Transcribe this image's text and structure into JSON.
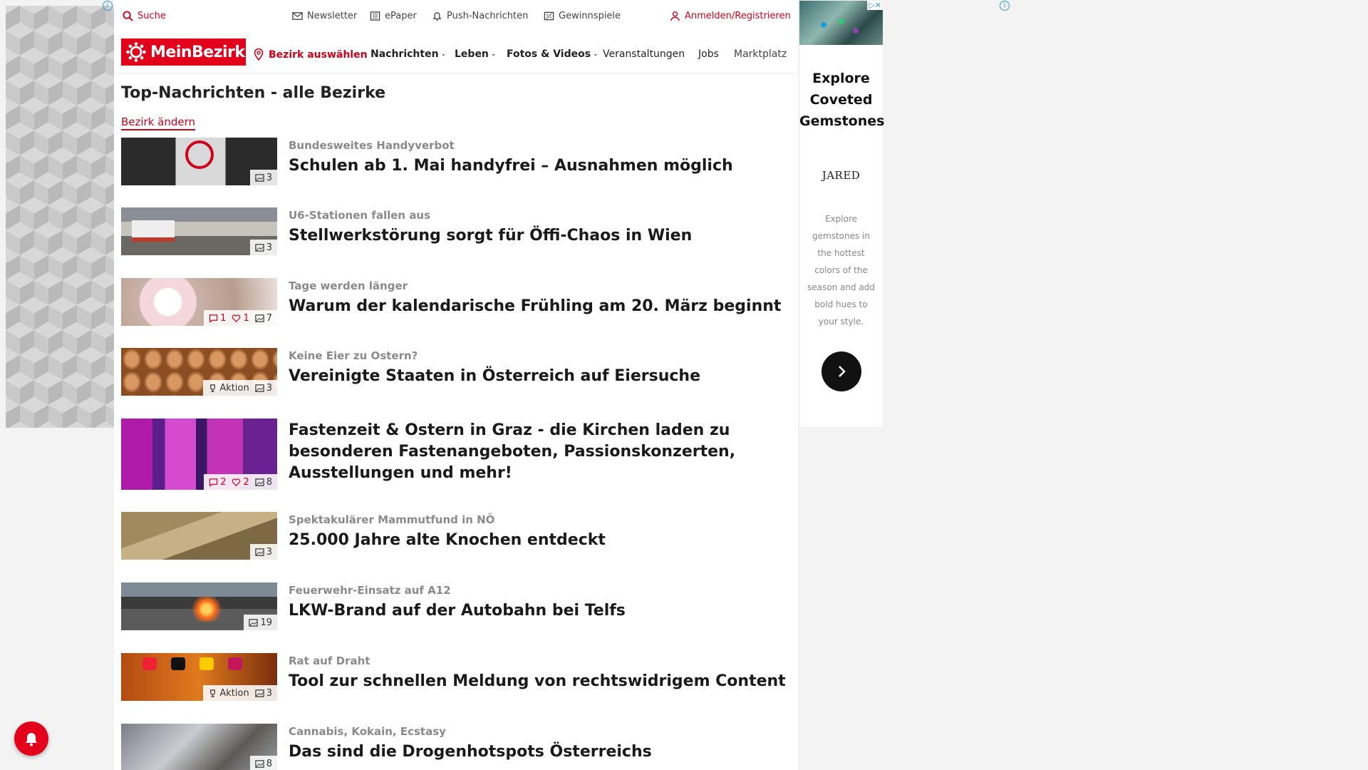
{
  "utility_nav": {
    "search": "Suche",
    "newsletter": "Newsletter",
    "epaper": "ePaper",
    "push": "Push-Nachrichten",
    "games": "Gewinnspiele",
    "login": "Anmelden/Registrieren"
  },
  "main_nav": {
    "logo": "MeinBezirk",
    "district": "Bezirk auswählen",
    "items": [
      "Nachrichten",
      "Leben",
      "Fotos & Videos",
      "Veranstaltungen",
      "Jobs",
      "Marktplatz"
    ]
  },
  "page": {
    "title": "Top-Nachrichten - alle Bezirke",
    "change_district": "Bezirk ändern"
  },
  "articles": [
    {
      "kicker": "Bundesweites Handyverbot",
      "headline": "Schulen ab 1. Mai handyfrei – Ausnahmen möglich",
      "photos": "3"
    },
    {
      "kicker": "U6-Stationen fallen aus",
      "headline": "Stellwerkstörung sorgt für Öffi-Chaos in Wien",
      "photos": "3"
    },
    {
      "kicker": "Tage werden länger",
      "headline": "Warum der kalendarische Frühling am 20. März beginnt",
      "comments": "1",
      "likes": "1",
      "photos": "7"
    },
    {
      "kicker": "Keine Eier zu Ostern?",
      "headline": "Vereinigte Staaten in Österreich auf Eiersuche",
      "action": "Aktion",
      "photos": "3"
    },
    {
      "kicker": "",
      "headline": "Fastenzeit & Ostern in Graz - die Kirchen laden zu besonderen Fastenangeboten, Passionskonzerten, Ausstellungen und mehr!",
      "comments": "2",
      "likes": "2",
      "photos": "8"
    },
    {
      "kicker": "Spektakulärer Mammutfund in NÖ",
      "headline": "25.000 Jahre alte Knochen entdeckt",
      "photos": "3"
    },
    {
      "kicker": "Feuerwehr-Einsatz auf A12",
      "headline": "LKW-Brand auf der Autobahn bei Telfs",
      "photos": "19"
    },
    {
      "kicker": "Rat auf Draht",
      "headline": "Tool zur schnellen Meldung von rechtswidrigem Content",
      "action": "Aktion",
      "photos": "3"
    },
    {
      "kicker": "Cannabis, Kokain, Ecstasy",
      "headline": "Das sind die Drogenhotspots Österreichs",
      "photos": "8"
    }
  ],
  "ad": {
    "headline_1": "Explore",
    "headline_2": "Coveted",
    "headline_3": "Gemstones",
    "brand": "JARED",
    "body": "Explore gemstones in the hottest colors of the season and add bold hues to your style."
  },
  "icons": {
    "search": "search-icon",
    "mail": "mail-icon",
    "newspaper": "newspaper-icon",
    "bell": "bell-icon",
    "ticket": "ticket-icon",
    "user": "user-icon",
    "pin": "map-pin-icon",
    "photo": "image-icon",
    "comment": "comment-icon",
    "heart": "heart-icon",
    "trophy": "trophy-icon"
  },
  "colors": {
    "brand": "#e2001a",
    "accent": "#d0021b"
  }
}
